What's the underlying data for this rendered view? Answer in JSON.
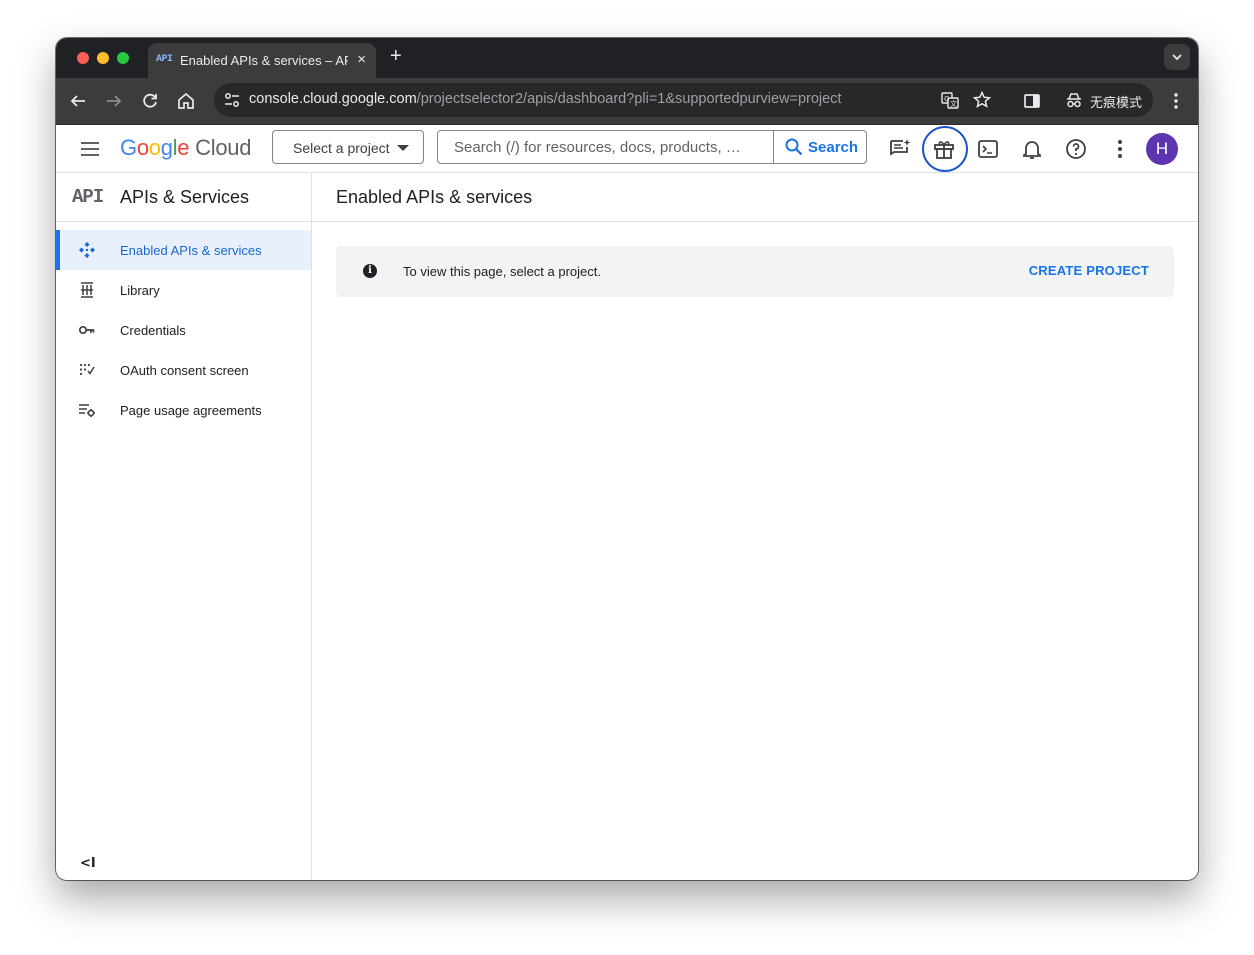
{
  "browser": {
    "tab_favicon": "API",
    "tab_title": "Enabled APIs & services – APIs & Services",
    "tab_close": "×",
    "new_tab": "+",
    "url_host": "console.cloud.google.com",
    "url_path": "/projectselector2/apis/dashboard?pli=1&supportedpurview=project",
    "incognito_label": "无痕模式",
    "traffic_colors": [
      "#ff5f57",
      "#febc2e",
      "#28c840"
    ]
  },
  "header": {
    "logo_letters": [
      "G",
      "o",
      "o",
      "g",
      "l",
      "e"
    ],
    "logo_product": "Cloud",
    "project_selector": "Select a project",
    "search_placeholder": "Search (/) for resources, docs, products, …",
    "search_button": "Search",
    "avatar_initial": "H",
    "avatar_color": "#5e35b1",
    "icons": [
      "menu-icon",
      "feedback-icon",
      "gift-icon",
      "cloud-shell-icon",
      "notifications-icon",
      "help-icon",
      "more-vert-icon"
    ]
  },
  "sidebar": {
    "logo": "API",
    "title": "APIs & Services",
    "items": [
      {
        "label": "Enabled APIs & services",
        "icon": "api-dashboard-icon",
        "active": true
      },
      {
        "label": "Library",
        "icon": "library-icon",
        "active": false
      },
      {
        "label": "Credentials",
        "icon": "key-icon",
        "active": false
      },
      {
        "label": "OAuth consent screen",
        "icon": "oauth-grid-icon",
        "active": false
      },
      {
        "label": "Page usage agreements",
        "icon": "settings-list-icon",
        "active": false
      }
    ],
    "collapse_label": "<I"
  },
  "main": {
    "title": "Enabled APIs & services",
    "notice": {
      "message": "To view this page, select a project.",
      "action": "CREATE PROJECT"
    }
  },
  "colors": {
    "accent": "#1a73e8",
    "active_bg": "#e8f0fe",
    "gift_highlight": "#1a56c9"
  }
}
